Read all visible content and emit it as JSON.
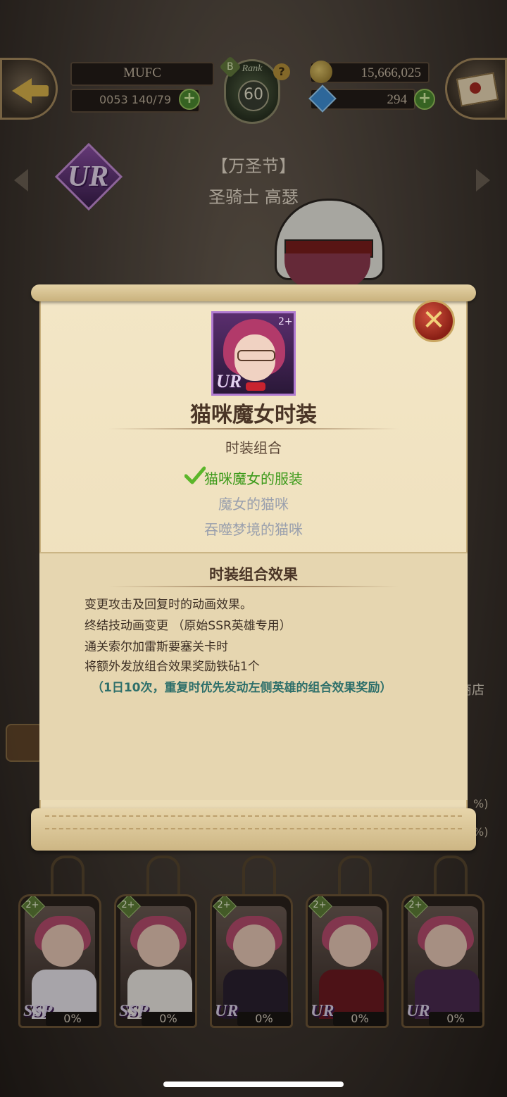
{
  "hud": {
    "player_name": "MUFC",
    "stamina": "0053 140/79",
    "rank_label": "Rank",
    "rank_value": "60",
    "rank_badge": "B",
    "gold": "15,666,025",
    "gems": "294"
  },
  "hero": {
    "rarity": "UR",
    "event": "【万圣节】",
    "name": "圣骑士 高瑟"
  },
  "side": {
    "shop_label": "商店",
    "pct_a": "%)",
    "pct_b": "%)"
  },
  "modal": {
    "portrait_rarity": "UR",
    "portrait_level": "2+",
    "title": "猫咪魔女时装",
    "set_label": "时装组合",
    "set_items": [
      {
        "label": "猫咪魔女的服装",
        "owned": true
      },
      {
        "label": "魔女的猫咪",
        "owned": false
      },
      {
        "label": "吞噬梦境的猫咪",
        "owned": false
      }
    ],
    "effect_title": "时装组合效果",
    "effect_lines": [
      "变更攻击及回复时的动画效果。",
      "终结技动画变更 （原始SSR英雄专用）",
      "通关索尔加雷斯要塞关卡时",
      "将额外发放组合效果奖励铁砧1个"
    ],
    "effect_note": "（1日10次，重复时优先发动左侧英雄的组合效果奖励）",
    "close_icon": "close-x-icon"
  },
  "cards": [
    {
      "rarity": "SSR",
      "pct": "0%",
      "level": "2+",
      "outfit": "#e8e4ea"
    },
    {
      "rarity": "SSR",
      "pct": "0%",
      "level": "2+",
      "outfit": "#ece8e2"
    },
    {
      "rarity": "UR",
      "pct": "0%",
      "level": "2+",
      "outfit": "#2a2030"
    },
    {
      "rarity": "UR",
      "pct": "0%",
      "level": "2+",
      "outfit": "#6b1a20"
    },
    {
      "rarity": "UR",
      "pct": "0%",
      "level": "2+",
      "outfit": "#4a2a50"
    }
  ],
  "colors": {
    "parchment": "#f3e6c6",
    "owned_green": "#3c9a1a",
    "unowned_gray": "#9aa0ad",
    "note_teal": "#2d6f6a"
  }
}
